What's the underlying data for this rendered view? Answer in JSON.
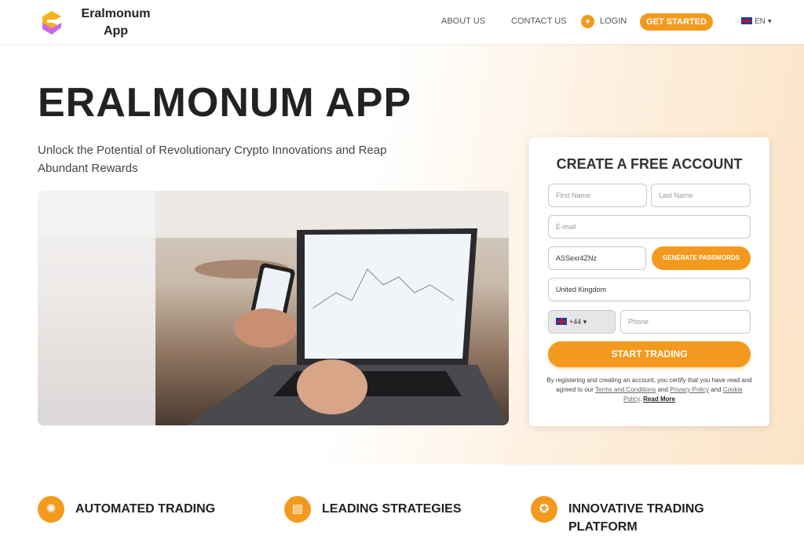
{
  "header": {
    "brand": "Eralmonum App",
    "nav": [
      "ABOUT US",
      "CONTACT US"
    ],
    "login": "LOGIN",
    "get_started": "GET STARTED",
    "lang": "EN"
  },
  "hero": {
    "title": "ERALMONUM APP",
    "subtitle": "Unlock the Potential of Revolutionary Crypto Innovations and Reap Abundant Rewards"
  },
  "form": {
    "title": "CREATE A FREE ACCOUNT",
    "first_name": "First Name",
    "last_name": "Last Name",
    "email": "E-mail",
    "password": "ASSexr4ZNz",
    "generate": "GENERATE PASSWORDS",
    "country": "United Kingdom",
    "code": "+44",
    "phone": "Phone",
    "submit": "START TRADING",
    "legal_pre": "By registering and creating an account, you certify that you have read and agreed to our",
    "terms": "Terms and Conditions",
    "and1": "and",
    "privacy": "Privacy Policy",
    "and2": "and",
    "cookie": "Cookie Policy",
    "sep": ".",
    "read_more": "Read More"
  },
  "features": [
    {
      "title": "AUTOMATED TRADING",
      "icon": "gear-icon"
    },
    {
      "title": "LEADING STRATEGIES",
      "icon": "chart-icon"
    },
    {
      "title": "INNOVATIVE TRADING PLATFORM",
      "icon": "award-icon"
    }
  ],
  "colors": {
    "accent": "#f39a1e"
  }
}
